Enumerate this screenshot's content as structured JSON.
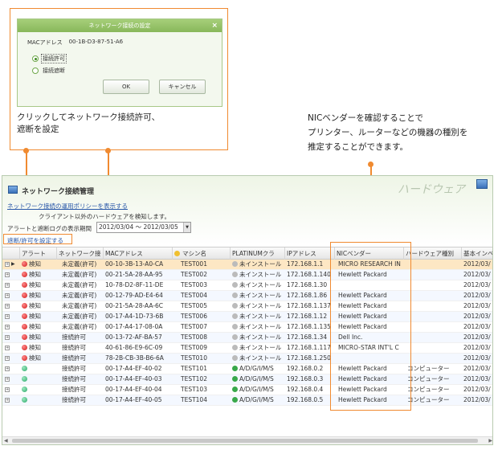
{
  "dialog": {
    "title": "ネットワーク接続の設定",
    "close": "×",
    "mac_label": "MACアドレス",
    "mac_value": "00-1B-D3-87-51-A6",
    "options": [
      "接続許可",
      "接続遮断"
    ],
    "ok": "OK",
    "cancel": "キャンセル"
  },
  "callout1": {
    "line1": "クリックしてネットワーク接続許可、",
    "line2": "遮断を設定"
  },
  "callout2": {
    "line1": "NICベンダーを確認することで",
    "line2": "プリンター、ルーターなどの機器の種別を",
    "line3": "推定することができます。"
  },
  "window": {
    "title": "ネットワーク接続管理",
    "section_title": "ハードウェア",
    "policy_link": "ネットワーク接続の運用ポリシーを表示する",
    "detect_text": "クライアント以外のハードウェアを検知します。",
    "period_label": "アラートと遮断ログの表示期間",
    "period_value": "2012/03/04 ～ 2012/03/05",
    "set_link": "遮断/許可を設定する"
  },
  "table": {
    "headers": [
      "アラート",
      "ネットワーク接",
      "MACアドレス",
      "マシン名",
      "PLATINUMクラ",
      "IPアドレス",
      "NICベンダー",
      "ハードウェア種別",
      "基本インベ"
    ],
    "rows": [
      {
        "alert": "検知",
        "status": "未定義(許可)",
        "mac": "00-10-3B-13-A0-CA",
        "machine": "TEST001",
        "platinum": "未インストール",
        "ip": "172.168.1.1",
        "vendor": "MICRO RESEARCH IN",
        "hwtype": "",
        "date": "2012/03/"
      },
      {
        "alert": "検知",
        "status": "未定義(許可)",
        "mac": "00-21-5A-28-AA-95",
        "machine": "TEST002",
        "platinum": "未インストール",
        "ip": "172.168.1.140",
        "vendor": "Hewlett Packard",
        "hwtype": "",
        "date": "2012/03/"
      },
      {
        "alert": "検知",
        "status": "未定義(許可)",
        "mac": "10-78-D2-8F-11-DE",
        "machine": "TEST003",
        "platinum": "未インストール",
        "ip": "172.168.1.30",
        "vendor": "",
        "hwtype": "",
        "date": "2012/03/"
      },
      {
        "alert": "検知",
        "status": "未定義(許可)",
        "mac": "00-12-79-AD-E4-64",
        "machine": "TEST004",
        "platinum": "未インストール",
        "ip": "172.168.1.86",
        "vendor": "Hewlett Packard",
        "hwtype": "",
        "date": "2012/03/"
      },
      {
        "alert": "検知",
        "status": "未定義(許可)",
        "mac": "00-21-5A-28-AA-6C",
        "machine": "TEST005",
        "platinum": "未インストール",
        "ip": "172.168.1.137",
        "vendor": "Hewlett Packard",
        "hwtype": "",
        "date": "2012/03/"
      },
      {
        "alert": "検知",
        "status": "未定義(許可)",
        "mac": "00-17-A4-1D-73-6B",
        "machine": "TEST006",
        "platinum": "未インストール",
        "ip": "172.168.1.12",
        "vendor": "Hewlett Packard",
        "hwtype": "",
        "date": "2012/03/"
      },
      {
        "alert": "検知",
        "status": "未定義(許可)",
        "mac": "00-17-A4-17-08-0A",
        "machine": "TEST007",
        "platinum": "未インストール",
        "ip": "172.168.1.135",
        "vendor": "Hewlett Packard",
        "hwtype": "",
        "date": "2012/03/"
      },
      {
        "alert": "検知",
        "status": "接続許可",
        "mac": "00-13-72-AF-BA-57",
        "machine": "TEST008",
        "platinum": "未インストール",
        "ip": "172.168.1.34",
        "vendor": "Dell Inc.",
        "hwtype": "",
        "date": "2012/03/"
      },
      {
        "alert": "検知",
        "status": "接続許可",
        "mac": "40-61-86-E9-6C-09",
        "machine": "TEST009",
        "platinum": "未インストール",
        "ip": "172.168.1.117",
        "vendor": "MICRO-STAR INT'L C",
        "hwtype": "",
        "date": "2012/03/"
      },
      {
        "alert": "検知",
        "status": "接続許可",
        "mac": "78-2B-CB-3B-B6-6A",
        "machine": "TEST010",
        "platinum": "未インストール",
        "ip": "172.168.1.250",
        "vendor": "",
        "hwtype": "",
        "date": "2012/03/"
      },
      {
        "alert": "",
        "status": "接続許可",
        "mac": "00-17-A4-EF-40-02",
        "machine": "TEST101",
        "platinum": "A/D/G/I/M/S",
        "ip": "192.168.0.2",
        "vendor": "Hewlett Packard",
        "hwtype": "コンピューター",
        "date": "2012/03/"
      },
      {
        "alert": "",
        "status": "接続許可",
        "mac": "00-17-A4-EF-40-03",
        "machine": "TEST102",
        "platinum": "A/D/G/I/M/S",
        "ip": "192.168.0.3",
        "vendor": "Hewlett Packard",
        "hwtype": "コンピューター",
        "date": "2012/03/"
      },
      {
        "alert": "",
        "status": "接続許可",
        "mac": "00-17-A4-EF-40-04",
        "machine": "TEST103",
        "platinum": "A/D/G/I/M/S",
        "ip": "192.168.0.4",
        "vendor": "Hewlett Packard",
        "hwtype": "コンピューター",
        "date": "2012/03/"
      },
      {
        "alert": "",
        "status": "接続許可",
        "mac": "00-17-A4-EF-40-05",
        "machine": "TEST104",
        "platinum": "A/D/G/I/M/S",
        "ip": "192.168.0.5",
        "vendor": "Hewlett Packard",
        "hwtype": "コンピューター",
        "date": "2012/03/"
      }
    ]
  },
  "colors": {
    "accent": "#f08a30",
    "link": "#2857a8",
    "selected_row": "#fde7c4"
  }
}
